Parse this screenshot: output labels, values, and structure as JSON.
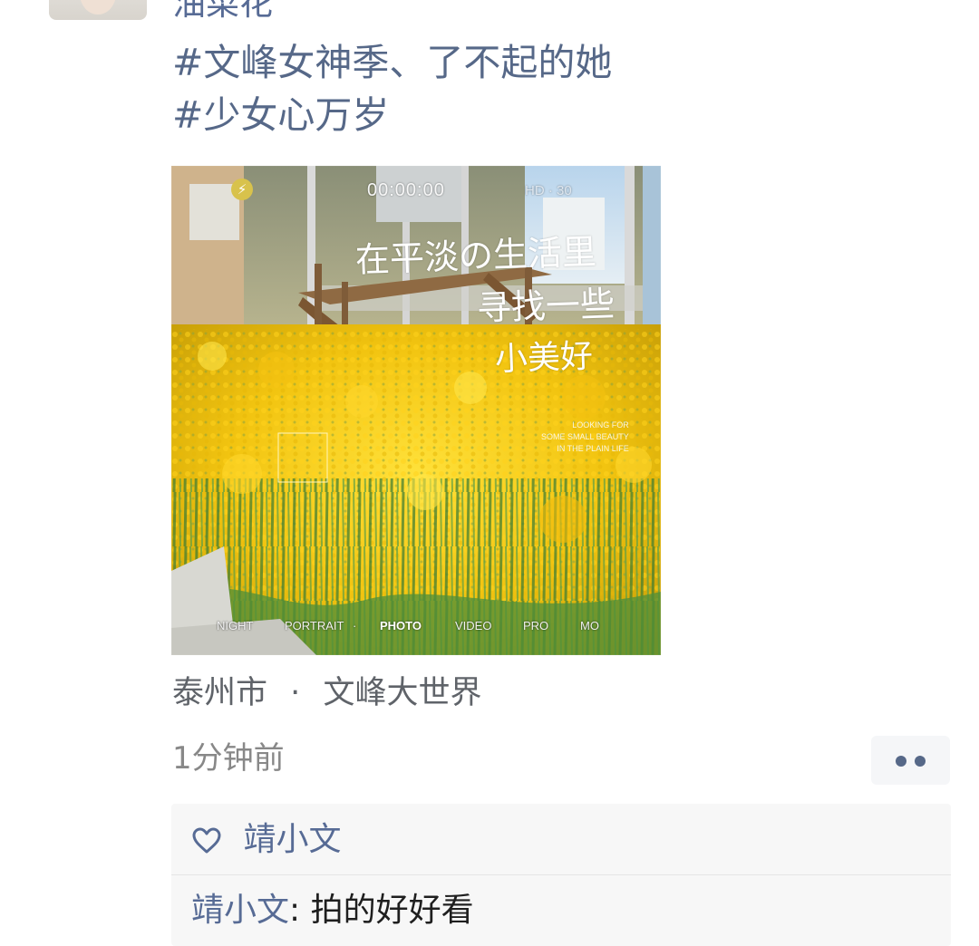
{
  "post": {
    "author": "油菜花",
    "text_lines": [
      "#文峰女神季、了不起的她",
      "#少女心万岁"
    ],
    "location": {
      "city": "泰州市",
      "separator": "·",
      "place": "文峰大世界"
    },
    "timestamp": "1分钟前"
  },
  "photo": {
    "camera_overlay": {
      "flash": "⚡",
      "timer": "00:00:00",
      "quality": "HD · 30",
      "modes": [
        "NIGHT",
        "PORTRAIT",
        "·",
        "PHOTO",
        "VIDEO",
        "PRO",
        "MO"
      ]
    },
    "handwriting": {
      "line1": "在平淡の生活里",
      "line2": "寻找一些",
      "line3": "小美好"
    },
    "caption_lines": [
      "LOOKING FOR",
      "SOME SMALL BEAUTY",
      "IN THE PLAIN LIFE"
    ]
  },
  "interactions": {
    "more_icon": "more-icon",
    "likes": [
      "靖小文"
    ],
    "comments": [
      {
        "author": "靖小文",
        "separator": ":",
        "text": "拍的好好看"
      }
    ]
  },
  "colors": {
    "name_blue": "#576b95",
    "tag_blue": "#566888",
    "gray_text": "#888888",
    "comment_bg": "#f7f7f7"
  }
}
